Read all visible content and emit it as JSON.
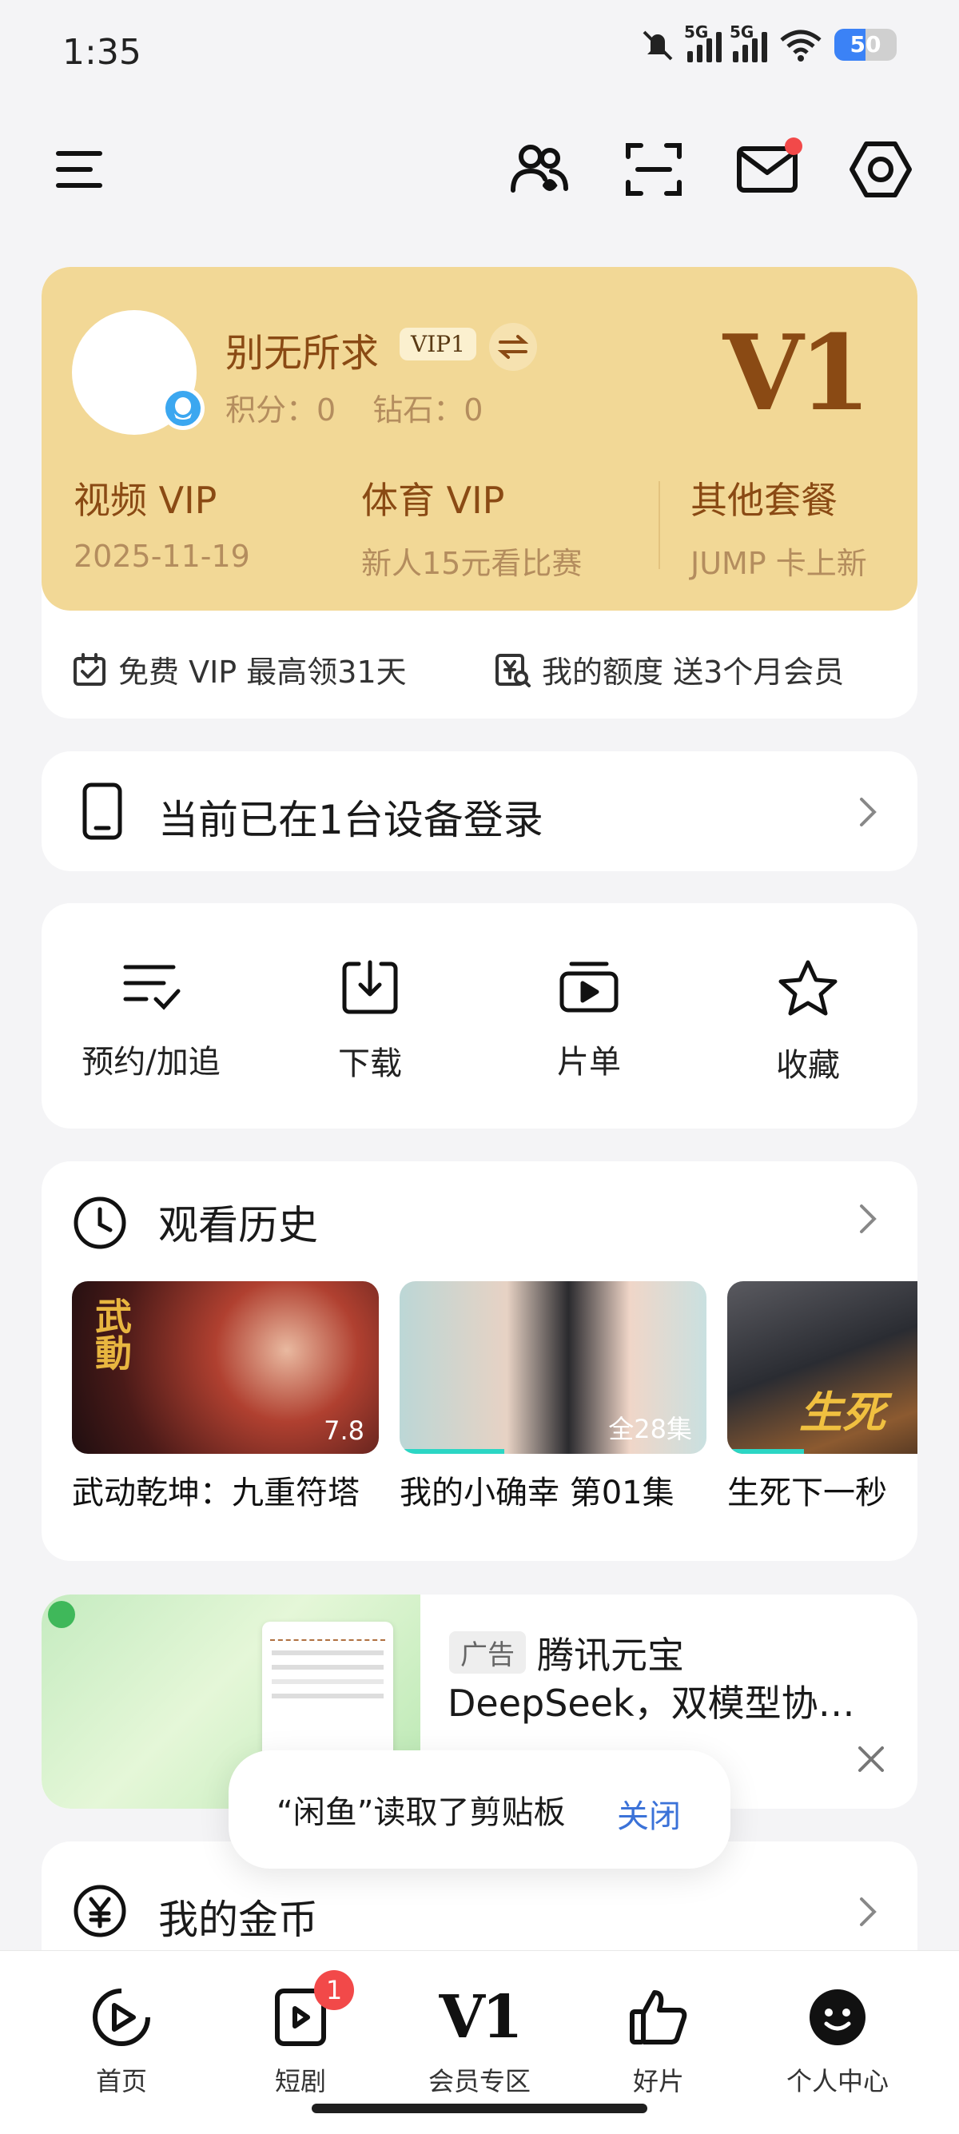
{
  "status_bar": {
    "time": "1:35",
    "battery": "50",
    "net1": "5G",
    "net2": "5G"
  },
  "top_bar": {
    "icons": [
      "menu-icon",
      "friends-icon",
      "scan-icon",
      "mail-icon",
      "settings-icon"
    ]
  },
  "vip": {
    "username": "别无所求",
    "level_pill": "VIP1",
    "points": "积分：0",
    "diamonds": "钻石：0",
    "level_big": "V1",
    "columns": [
      {
        "title": "视频 VIP",
        "sub": "2025-11-19"
      },
      {
        "title": "体育 VIP",
        "sub": "新人15元看比赛"
      },
      {
        "title": "其他套餐",
        "sub": "JUMP 卡上新"
      }
    ],
    "promo_left": "免费 VIP 最高领31天",
    "promo_right": "我的额度 送3个月会员"
  },
  "device": {
    "text": "当前已在1台设备登录"
  },
  "quick": [
    {
      "label": "预约/加追",
      "icon": "checklist-icon"
    },
    {
      "label": "下载",
      "icon": "download-icon"
    },
    {
      "label": "片单",
      "icon": "playlist-icon"
    },
    {
      "label": "收藏",
      "icon": "star-icon"
    }
  ],
  "history": {
    "title": "观看历史",
    "items": [
      {
        "caption": "武动乾坤：九重符塔",
        "badge": "7.8",
        "progress": 0
      },
      {
        "caption": "我的小确幸 第01集",
        "badge": "全28集",
        "progress": 0.34
      },
      {
        "caption": "生死下一秒",
        "badge": "",
        "progress": 0.25
      }
    ]
  },
  "ad": {
    "tag": "广告",
    "title": "腾讯元宝",
    "desc": "DeepSeek，双模型协…"
  },
  "coins": {
    "title": "我的金币"
  },
  "toast": {
    "text": "“闲鱼”读取了剪贴板",
    "action": "关闭"
  },
  "tabbar": {
    "items": [
      {
        "label": "首页"
      },
      {
        "label": "短剧",
        "badge": "1"
      },
      {
        "label": "会员专区",
        "glyph": "V1"
      },
      {
        "label": "好片"
      },
      {
        "label": "个人中心"
      }
    ]
  },
  "colors": {
    "gold_bg": "#f2d896",
    "gold_text": "#8a4a14",
    "accent_blue": "#3b72d8",
    "badge_red": "#f24949"
  }
}
